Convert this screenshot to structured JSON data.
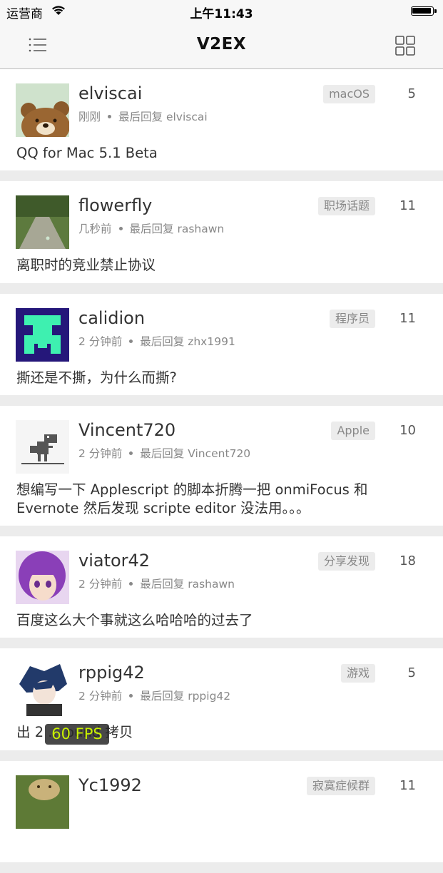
{
  "status_bar": {
    "carrier": "运营商",
    "time": "上午11:43",
    "battery_level": 0.95
  },
  "nav": {
    "title": "V2EX",
    "left_icon": "list-menu-icon",
    "right_icon": "grid-icon"
  },
  "topics": [
    {
      "username": "elviscai",
      "time": "刚刚",
      "last_reply": "最后回复 elviscai",
      "node": "macOS",
      "replies": "5",
      "title": "QQ for Mac 5.1 Beta",
      "avatar": "brown-bear"
    },
    {
      "username": "flowerfly",
      "time": "几秒前",
      "last_reply": "最后回复 rashawn",
      "node": "职场话题",
      "replies": "11",
      "title": "离职时的竞业禁止协议",
      "avatar": "path-photo"
    },
    {
      "username": "calidion",
      "time": "2 分钟前",
      "last_reply": "最后回复 zhx1991",
      "node": "程序员",
      "replies": "11",
      "title": "撕还是不撕，为什么而撕?",
      "avatar": "pixel-figure"
    },
    {
      "username": "Vincent720",
      "time": "2 分钟前",
      "last_reply": "最后回复 Vincent720",
      "node": "Apple",
      "replies": "10",
      "title": "想编写一下 Applescript 的脚本折腾一把 onmiFocus 和 Evernote 然后发现 scripte editor 没法用。。。",
      "avatar": "dino"
    },
    {
      "username": "viator42",
      "time": "2 分钟前",
      "last_reply": "最后回复 rashawn",
      "node": "分享发现",
      "replies": "18",
      "title": "百度这么大个事就这么哈哈哈的过去了",
      "avatar": "anime-girl"
    },
    {
      "username": "rppig42",
      "time": "2 分钟前",
      "last_reply": "最后回复 rppig42",
      "node": "游戏",
      "replies": "5",
      "title": "出 2 ... ound 拷贝",
      "avatar": "anime-boy"
    },
    {
      "username": "Yc1992",
      "time": "",
      "last_reply": "",
      "node": "寂寞症候群",
      "replies": "11",
      "title": "",
      "avatar": "photo"
    }
  ],
  "fps_overlay": "60 FPS"
}
